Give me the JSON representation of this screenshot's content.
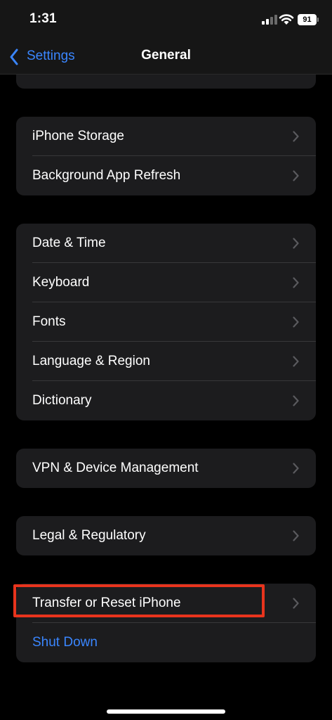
{
  "status": {
    "time": "1:31",
    "battery": "91"
  },
  "nav": {
    "back_label": "Settings",
    "title": "General"
  },
  "groups": [
    {
      "rows": [
        {
          "label": "iPhone Storage"
        },
        {
          "label": "Background App Refresh"
        }
      ]
    },
    {
      "rows": [
        {
          "label": "Date & Time"
        },
        {
          "label": "Keyboard"
        },
        {
          "label": "Fonts"
        },
        {
          "label": "Language & Region"
        },
        {
          "label": "Dictionary"
        }
      ]
    },
    {
      "rows": [
        {
          "label": "VPN & Device Management"
        }
      ]
    },
    {
      "rows": [
        {
          "label": "Legal & Regulatory"
        }
      ]
    },
    {
      "rows": [
        {
          "label": "Transfer or Reset iPhone"
        },
        {
          "label": "Shut Down"
        }
      ]
    }
  ],
  "colors": {
    "accent": "#3a86ff",
    "highlight": "#e8341d",
    "cell_bg": "#1c1c1e"
  }
}
